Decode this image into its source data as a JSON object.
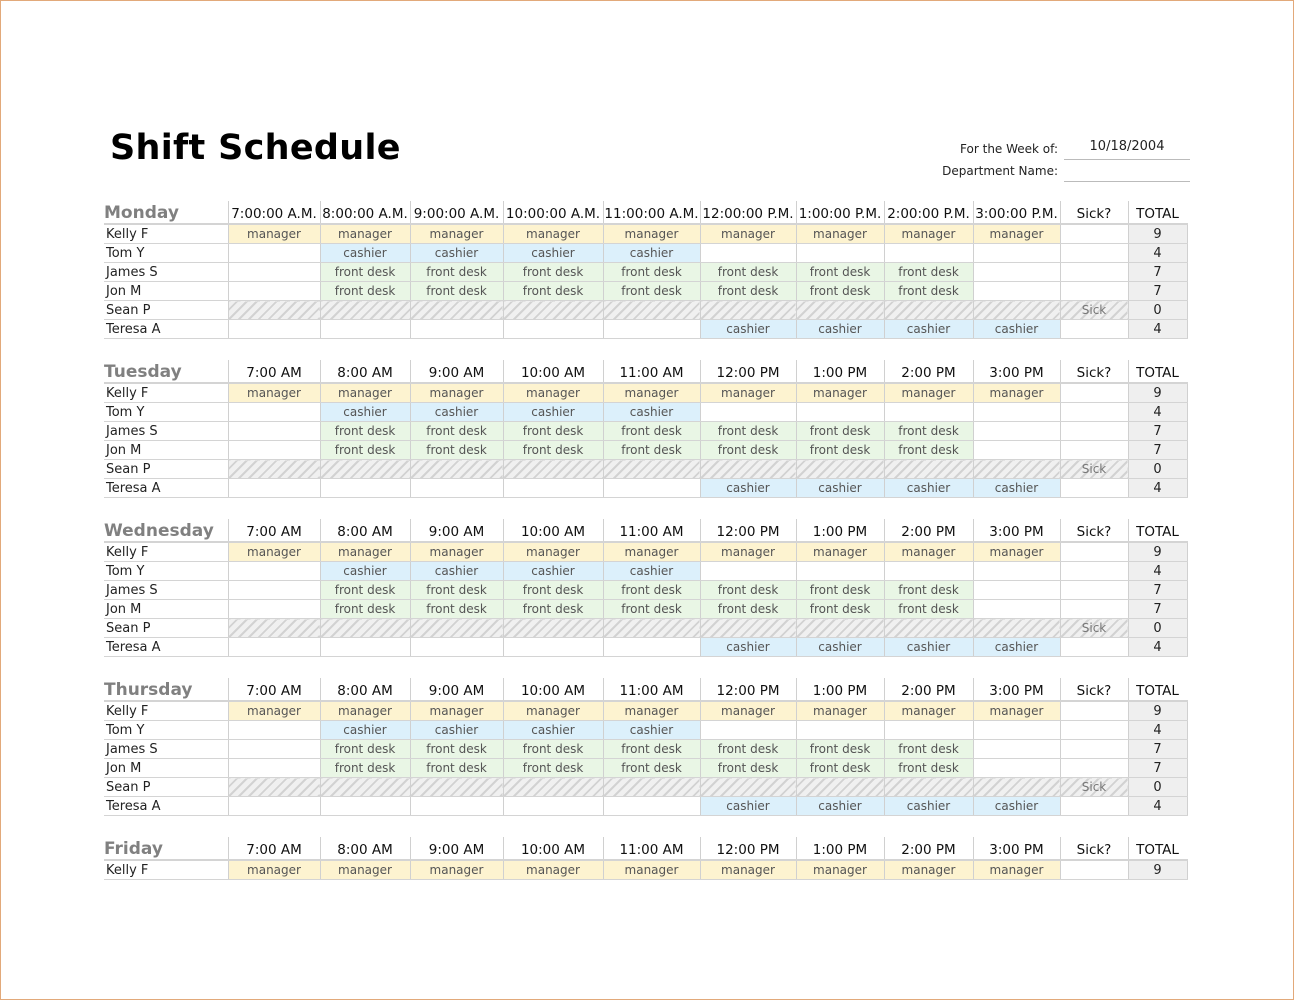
{
  "title": "Shift Schedule",
  "meta": {
    "week_label": "For the Week of:",
    "week_value": "10/18/2004",
    "dept_label": "Department Name:",
    "dept_value": ""
  },
  "colors": {
    "manager": "#fdf3d0",
    "cashier": "#dcf0fb",
    "front_desk": "#e9f6e5",
    "total_bg": "#efefef",
    "day_heading": "#808080",
    "page_border": "#e2a97a"
  },
  "days": [
    {
      "name": "Monday",
      "times": [
        "7:00:00 A.M.",
        "8:00:00 A.M.",
        "9:00:00 A.M.",
        "10:00:00 A.M.",
        "11:00:00 A.M.",
        "12:00:00 P.M.",
        "1:00:00 P.M.",
        "2:00:00 P.M.",
        "3:00:00 P.M."
      ],
      "sick_header": "Sick?",
      "total_header": "TOTAL",
      "rows": [
        {
          "name": "Kelly F",
          "shifts": [
            "manager",
            "manager",
            "manager",
            "manager",
            "manager",
            "manager",
            "manager",
            "manager",
            "manager"
          ],
          "sick": "",
          "total": "9"
        },
        {
          "name": "Tom Y",
          "shifts": [
            "",
            "cashier",
            "cashier",
            "cashier",
            "cashier",
            "",
            "",
            "",
            ""
          ],
          "sick": "",
          "total": "4"
        },
        {
          "name": "James S",
          "shifts": [
            "",
            "front desk",
            "front desk",
            "front desk",
            "front desk",
            "front desk",
            "front desk",
            "front desk",
            ""
          ],
          "sick": "",
          "total": "7"
        },
        {
          "name": "Jon M",
          "shifts": [
            "",
            "front desk",
            "front desk",
            "front desk",
            "front desk",
            "front desk",
            "front desk",
            "front desk",
            ""
          ],
          "sick": "",
          "total": "7"
        },
        {
          "name": "Sean P",
          "shifts": [
            "",
            "",
            "",
            "",
            "",
            "",
            "",
            "",
            ""
          ],
          "sick": "Sick",
          "total": "0",
          "is_sick": true
        },
        {
          "name": "Teresa A",
          "shifts": [
            "",
            "",
            "",
            "",
            "",
            "cashier",
            "cashier",
            "cashier",
            "cashier"
          ],
          "sick": "",
          "total": "4"
        }
      ]
    },
    {
      "name": "Tuesday",
      "times": [
        "7:00 AM",
        "8:00 AM",
        "9:00 AM",
        "10:00 AM",
        "11:00 AM",
        "12:00 PM",
        "1:00 PM",
        "2:00 PM",
        "3:00 PM"
      ],
      "sick_header": "Sick?",
      "total_header": "TOTAL",
      "rows": [
        {
          "name": "Kelly F",
          "shifts": [
            "manager",
            "manager",
            "manager",
            "manager",
            "manager",
            "manager",
            "manager",
            "manager",
            "manager"
          ],
          "sick": "",
          "total": "9"
        },
        {
          "name": "Tom Y",
          "shifts": [
            "",
            "cashier",
            "cashier",
            "cashier",
            "cashier",
            "",
            "",
            "",
            ""
          ],
          "sick": "",
          "total": "4"
        },
        {
          "name": "James S",
          "shifts": [
            "",
            "front desk",
            "front desk",
            "front desk",
            "front desk",
            "front desk",
            "front desk",
            "front desk",
            ""
          ],
          "sick": "",
          "total": "7"
        },
        {
          "name": "Jon M",
          "shifts": [
            "",
            "front desk",
            "front desk",
            "front desk",
            "front desk",
            "front desk",
            "front desk",
            "front desk",
            ""
          ],
          "sick": "",
          "total": "7"
        },
        {
          "name": "Sean P",
          "shifts": [
            "",
            "",
            "",
            "",
            "",
            "",
            "",
            "",
            ""
          ],
          "sick": "Sick",
          "total": "0",
          "is_sick": true
        },
        {
          "name": "Teresa A",
          "shifts": [
            "",
            "",
            "",
            "",
            "",
            "cashier",
            "cashier",
            "cashier",
            "cashier"
          ],
          "sick": "",
          "total": "4"
        }
      ]
    },
    {
      "name": "Wednesday",
      "times": [
        "7:00 AM",
        "8:00 AM",
        "9:00 AM",
        "10:00 AM",
        "11:00 AM",
        "12:00 PM",
        "1:00 PM",
        "2:00 PM",
        "3:00 PM"
      ],
      "sick_header": "Sick?",
      "total_header": "TOTAL",
      "rows": [
        {
          "name": "Kelly F",
          "shifts": [
            "manager",
            "manager",
            "manager",
            "manager",
            "manager",
            "manager",
            "manager",
            "manager",
            "manager"
          ],
          "sick": "",
          "total": "9"
        },
        {
          "name": "Tom Y",
          "shifts": [
            "",
            "cashier",
            "cashier",
            "cashier",
            "cashier",
            "",
            "",
            "",
            ""
          ],
          "sick": "",
          "total": "4"
        },
        {
          "name": "James S",
          "shifts": [
            "",
            "front desk",
            "front desk",
            "front desk",
            "front desk",
            "front desk",
            "front desk",
            "front desk",
            ""
          ],
          "sick": "",
          "total": "7"
        },
        {
          "name": "Jon M",
          "shifts": [
            "",
            "front desk",
            "front desk",
            "front desk",
            "front desk",
            "front desk",
            "front desk",
            "front desk",
            ""
          ],
          "sick": "",
          "total": "7"
        },
        {
          "name": "Sean P",
          "shifts": [
            "",
            "",
            "",
            "",
            "",
            "",
            "",
            "",
            ""
          ],
          "sick": "Sick",
          "total": "0",
          "is_sick": true
        },
        {
          "name": "Teresa A",
          "shifts": [
            "",
            "",
            "",
            "",
            "",
            "cashier",
            "cashier",
            "cashier",
            "cashier"
          ],
          "sick": "",
          "total": "4"
        }
      ]
    },
    {
      "name": "Thursday",
      "times": [
        "7:00 AM",
        "8:00 AM",
        "9:00 AM",
        "10:00 AM",
        "11:00 AM",
        "12:00 PM",
        "1:00 PM",
        "2:00 PM",
        "3:00 PM"
      ],
      "sick_header": "Sick?",
      "total_header": "TOTAL",
      "rows": [
        {
          "name": "Kelly F",
          "shifts": [
            "manager",
            "manager",
            "manager",
            "manager",
            "manager",
            "manager",
            "manager",
            "manager",
            "manager"
          ],
          "sick": "",
          "total": "9"
        },
        {
          "name": "Tom Y",
          "shifts": [
            "",
            "cashier",
            "cashier",
            "cashier",
            "cashier",
            "",
            "",
            "",
            ""
          ],
          "sick": "",
          "total": "4"
        },
        {
          "name": "James S",
          "shifts": [
            "",
            "front desk",
            "front desk",
            "front desk",
            "front desk",
            "front desk",
            "front desk",
            "front desk",
            ""
          ],
          "sick": "",
          "total": "7"
        },
        {
          "name": "Jon M",
          "shifts": [
            "",
            "front desk",
            "front desk",
            "front desk",
            "front desk",
            "front desk",
            "front desk",
            "front desk",
            ""
          ],
          "sick": "",
          "total": "7"
        },
        {
          "name": "Sean P",
          "shifts": [
            "",
            "",
            "",
            "",
            "",
            "",
            "",
            "",
            ""
          ],
          "sick": "Sick",
          "total": "0",
          "is_sick": true
        },
        {
          "name": "Teresa A",
          "shifts": [
            "",
            "",
            "",
            "",
            "",
            "cashier",
            "cashier",
            "cashier",
            "cashier"
          ],
          "sick": "",
          "total": "4"
        }
      ]
    },
    {
      "name": "Friday",
      "times": [
        "7:00 AM",
        "8:00 AM",
        "9:00 AM",
        "10:00 AM",
        "11:00 AM",
        "12:00 PM",
        "1:00 PM",
        "2:00 PM",
        "3:00 PM"
      ],
      "sick_header": "Sick?",
      "total_header": "TOTAL",
      "rows": [
        {
          "name": "Kelly F",
          "shifts": [
            "manager",
            "manager",
            "manager",
            "manager",
            "manager",
            "manager",
            "manager",
            "manager",
            "manager"
          ],
          "sick": "",
          "total": "9"
        }
      ]
    }
  ]
}
